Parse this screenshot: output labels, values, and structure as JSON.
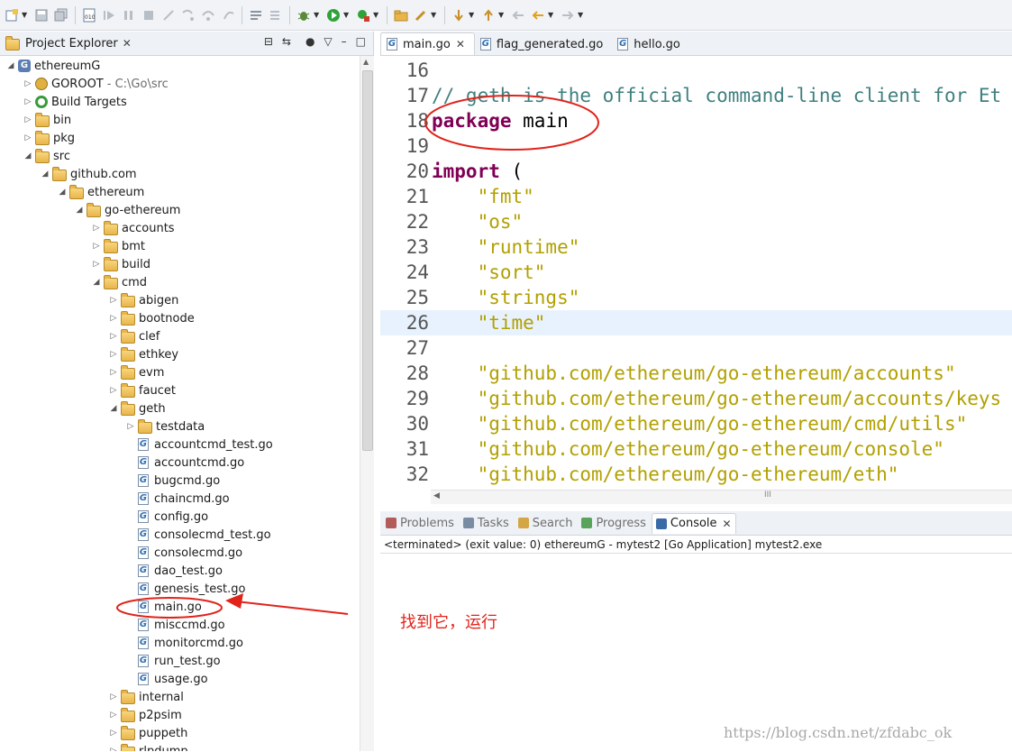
{
  "toolbar": {
    "icons": [
      "new-wizard-icon",
      "save-icon",
      "save-all-icon",
      "binary-icon",
      "resume-icon",
      "suspend-icon",
      "terminate-icon",
      "disconnect-icon",
      "step-into-icon",
      "step-over-icon",
      "step-return-icon",
      "open-console-icon",
      "drop-to-frame-icon",
      "debug-icon",
      "run-icon",
      "run-external-icon",
      "open-folder-icon",
      "pen-icon",
      "next-annotation-icon",
      "prev-annotation-icon",
      "last-edit-icon",
      "back-icon",
      "forward-icon"
    ]
  },
  "project_explorer": {
    "title": "Project Explorer",
    "close": "✕",
    "tree": [
      {
        "label": "ethereumG",
        "depth": 0,
        "expanded": true,
        "icon": "project"
      },
      {
        "label": "GOROOT",
        "secondary": "- C:\\Go\\src",
        "depth": 1,
        "expanded": false,
        "icon": "goroot"
      },
      {
        "label": "Build Targets",
        "depth": 1,
        "expanded": false,
        "icon": "target"
      },
      {
        "label": "bin",
        "depth": 1,
        "expanded": false,
        "icon": "folder"
      },
      {
        "label": "pkg",
        "depth": 1,
        "expanded": false,
        "icon": "folder"
      },
      {
        "label": "src",
        "depth": 1,
        "expanded": true,
        "icon": "folder"
      },
      {
        "label": "github.com",
        "depth": 2,
        "expanded": true,
        "icon": "folder"
      },
      {
        "label": "ethereum",
        "depth": 3,
        "expanded": true,
        "icon": "folder"
      },
      {
        "label": "go-ethereum",
        "depth": 4,
        "expanded": true,
        "icon": "folder"
      },
      {
        "label": "accounts",
        "depth": 5,
        "expanded": false,
        "icon": "folder"
      },
      {
        "label": "bmt",
        "depth": 5,
        "expanded": false,
        "icon": "folder"
      },
      {
        "label": "build",
        "depth": 5,
        "expanded": false,
        "icon": "folder"
      },
      {
        "label": "cmd",
        "depth": 5,
        "expanded": true,
        "icon": "folder"
      },
      {
        "label": "abigen",
        "depth": 6,
        "expanded": false,
        "icon": "folder"
      },
      {
        "label": "bootnode",
        "depth": 6,
        "expanded": false,
        "icon": "folder"
      },
      {
        "label": "clef",
        "depth": 6,
        "expanded": false,
        "icon": "folder"
      },
      {
        "label": "ethkey",
        "depth": 6,
        "expanded": false,
        "icon": "folder"
      },
      {
        "label": "evm",
        "depth": 6,
        "expanded": false,
        "icon": "folder"
      },
      {
        "label": "faucet",
        "depth": 6,
        "expanded": false,
        "icon": "folder"
      },
      {
        "label": "geth",
        "depth": 6,
        "expanded": true,
        "icon": "folder"
      },
      {
        "label": "testdata",
        "depth": 7,
        "expanded": false,
        "icon": "folder"
      },
      {
        "label": "accountcmd_test.go",
        "depth": 7,
        "icon": "gofile"
      },
      {
        "label": "accountcmd.go",
        "depth": 7,
        "icon": "gofile"
      },
      {
        "label": "bugcmd.go",
        "depth": 7,
        "icon": "gofile"
      },
      {
        "label": "chaincmd.go",
        "depth": 7,
        "icon": "gofile"
      },
      {
        "label": "config.go",
        "depth": 7,
        "icon": "gofile"
      },
      {
        "label": "consolecmd_test.go",
        "depth": 7,
        "icon": "gofile"
      },
      {
        "label": "consolecmd.go",
        "depth": 7,
        "icon": "gofile"
      },
      {
        "label": "dao_test.go",
        "depth": 7,
        "icon": "gofile"
      },
      {
        "label": "genesis_test.go",
        "depth": 7,
        "icon": "gofile"
      },
      {
        "label": "main.go",
        "depth": 7,
        "icon": "gofile"
      },
      {
        "label": "misccmd.go",
        "depth": 7,
        "icon": "gofile"
      },
      {
        "label": "monitorcmd.go",
        "depth": 7,
        "icon": "gofile"
      },
      {
        "label": "run_test.go",
        "depth": 7,
        "icon": "gofile"
      },
      {
        "label": "usage.go",
        "depth": 7,
        "icon": "gofile"
      },
      {
        "label": "internal",
        "depth": 6,
        "expanded": false,
        "icon": "folder"
      },
      {
        "label": "p2psim",
        "depth": 6,
        "expanded": false,
        "icon": "folder"
      },
      {
        "label": "puppeth",
        "depth": 6,
        "expanded": false,
        "icon": "folder"
      },
      {
        "label": "rlpdump",
        "depth": 6,
        "expanded": false,
        "icon": "folder"
      }
    ]
  },
  "editor": {
    "tabs": [
      {
        "label": "main.go",
        "active": true,
        "close": "✕"
      },
      {
        "label": "flag_generated.go",
        "active": false
      },
      {
        "label": "hello.go",
        "active": false
      }
    ],
    "lines": [
      {
        "n": "16",
        "parts": []
      },
      {
        "n": "17",
        "parts": [
          {
            "t": "cmt",
            "v": "// geth is the official command-line client for Et"
          }
        ]
      },
      {
        "n": "18",
        "parts": [
          {
            "t": "kw",
            "v": "package"
          },
          {
            "t": "txt",
            "v": " main"
          }
        ]
      },
      {
        "n": "19",
        "parts": []
      },
      {
        "n": "20",
        "parts": [
          {
            "t": "kw",
            "v": "import"
          },
          {
            "t": "txt",
            "v": " ("
          }
        ]
      },
      {
        "n": "21",
        "parts": [
          {
            "t": "txt",
            "v": "    "
          },
          {
            "t": "str",
            "v": "\"fmt\""
          }
        ]
      },
      {
        "n": "22",
        "parts": [
          {
            "t": "txt",
            "v": "    "
          },
          {
            "t": "str",
            "v": "\"os\""
          }
        ]
      },
      {
        "n": "23",
        "parts": [
          {
            "t": "txt",
            "v": "    "
          },
          {
            "t": "str",
            "v": "\"runtime\""
          }
        ]
      },
      {
        "n": "24",
        "parts": [
          {
            "t": "txt",
            "v": "    "
          },
          {
            "t": "str",
            "v": "\"sort\""
          }
        ]
      },
      {
        "n": "25",
        "parts": [
          {
            "t": "txt",
            "v": "    "
          },
          {
            "t": "str",
            "v": "\"strings\""
          }
        ]
      },
      {
        "n": "26",
        "hl": true,
        "parts": [
          {
            "t": "txt",
            "v": "    "
          },
          {
            "t": "str",
            "v": "\"time\""
          }
        ]
      },
      {
        "n": "27",
        "parts": []
      },
      {
        "n": "28",
        "parts": [
          {
            "t": "txt",
            "v": "    "
          },
          {
            "t": "str",
            "v": "\"github.com/ethereum/go-ethereum/accounts\""
          }
        ]
      },
      {
        "n": "29",
        "parts": [
          {
            "t": "txt",
            "v": "    "
          },
          {
            "t": "str",
            "v": "\"github.com/ethereum/go-ethereum/accounts/keys"
          }
        ]
      },
      {
        "n": "30",
        "parts": [
          {
            "t": "txt",
            "v": "    "
          },
          {
            "t": "str",
            "v": "\"github.com/ethereum/go-ethereum/cmd/utils\""
          }
        ]
      },
      {
        "n": "31",
        "parts": [
          {
            "t": "txt",
            "v": "    "
          },
          {
            "t": "str",
            "v": "\"github.com/ethereum/go-ethereum/console\""
          }
        ]
      },
      {
        "n": "32",
        "parts": [
          {
            "t": "txt",
            "v": "    "
          },
          {
            "t": "str",
            "v": "\"github.com/ethereum/go-ethereum/eth\""
          }
        ]
      }
    ],
    "hscroll_grip": "III"
  },
  "console": {
    "tabs": [
      {
        "label": "Problems",
        "icon": "problems-icon",
        "active": false
      },
      {
        "label": "Tasks",
        "icon": "tasks-icon",
        "active": false
      },
      {
        "label": "Search",
        "icon": "search-icon",
        "active": false
      },
      {
        "label": "Progress",
        "icon": "progress-icon",
        "active": false
      },
      {
        "label": "Console",
        "icon": "console-icon",
        "active": true,
        "close": "✕"
      }
    ],
    "status": "<terminated> (exit value: 0) ethereumG - mytest2 [Go Application] mytest2.exe"
  },
  "annotation": {
    "note": "找到它，运行",
    "color": "#e0241a"
  },
  "watermark": "https://blog.csdn.net/zfdabc_ok",
  "colors": {
    "keyword": "#7f0055",
    "string": "#b2a000",
    "comment": "#3f7f7f",
    "highlight": "#e8f2fe"
  }
}
